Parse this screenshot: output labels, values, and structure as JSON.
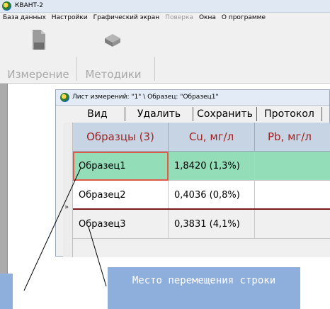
{
  "window": {
    "title": "КВАНТ-2",
    "icon": "kvant-app-icon"
  },
  "menubar": {
    "items": [
      {
        "label": "База данных",
        "enabled": true
      },
      {
        "label": "Настройки",
        "enabled": true
      },
      {
        "label": "Графический экран",
        "enabled": true
      },
      {
        "label": "Поверка",
        "enabled": false
      },
      {
        "label": "Окна",
        "enabled": true
      },
      {
        "label": "О программе",
        "enabled": true
      }
    ]
  },
  "toolbar": {
    "measurement": {
      "label": "Измерение",
      "icon": "flask-icon"
    },
    "methods": {
      "label": "Методики",
      "icon": "book-icon"
    }
  },
  "child_window": {
    "title": "Лист измерений: \"1\" \\ Образец: \"Образец1\"",
    "menu": {
      "view": "Вид",
      "delete": "Удалить",
      "save": "Сохранить",
      "report": "Протокол"
    },
    "grid": {
      "columns": [
        "Образцы (3)",
        "Cu, мг/л",
        "Pb, мг/л"
      ],
      "rows": [
        {
          "name": "Образец1",
          "cu": "1,8420 (1,3%)",
          "pb": ""
        },
        {
          "name": "Образец2",
          "cu": "0,4036 (0,8%)",
          "pb": ""
        },
        {
          "name": "Образец3",
          "cu": "0,3831 (4,1%)",
          "pb": ""
        }
      ],
      "row_marker": "»",
      "selected_row_color": "#93ddb8",
      "header_bg": "#c6d4e4",
      "header_text_color": "#a52222"
    }
  },
  "annotations": {
    "drop_target_label": "Место перемещения строки",
    "callout_color": "#8eaedb"
  }
}
